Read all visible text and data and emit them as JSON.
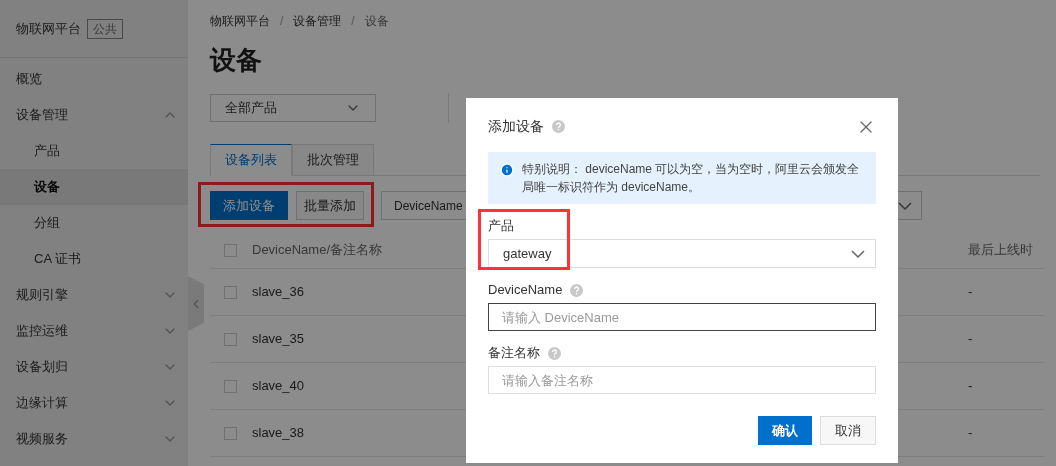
{
  "sidebar": {
    "title": "物联网平台",
    "tag": "公共",
    "items": [
      {
        "label": "概览",
        "selected": false
      },
      {
        "label": "设备管理",
        "selected": false,
        "expanded": true,
        "children": [
          {
            "label": "产品",
            "selected": false
          },
          {
            "label": "设备",
            "selected": true
          },
          {
            "label": "分组",
            "selected": false
          },
          {
            "label": "CA 证书",
            "selected": false
          }
        ]
      },
      {
        "label": "规则引擎",
        "selected": false,
        "expanded": false
      },
      {
        "label": "监控运维",
        "selected": false,
        "expanded": false
      },
      {
        "label": "设备划归",
        "selected": false,
        "expanded": false
      },
      {
        "label": "边缘计算",
        "selected": false,
        "expanded": false
      },
      {
        "label": "视频服务",
        "selected": false,
        "expanded": false
      }
    ]
  },
  "breadcrumb": [
    {
      "kind": "link",
      "text": "物联网平台"
    },
    {
      "kind": "separator",
      "text": "/"
    },
    {
      "kind": "link",
      "text": "设备管理"
    },
    {
      "kind": "separator",
      "text": "/"
    },
    {
      "kind": "current",
      "text": "设备"
    }
  ],
  "page_title": "设备",
  "product_select": {
    "value": "全部产品"
  },
  "tabs": [
    {
      "label": "设备列表",
      "selected": true
    },
    {
      "label": "批次管理",
      "selected": false
    }
  ],
  "toolbar": {
    "buttons": [
      {
        "label": "添加设备",
        "kind": "primary"
      },
      {
        "label": "批量添加",
        "kind": "secondary"
      }
    ],
    "filter": {
      "value": "DeviceName"
    }
  },
  "table": {
    "all_checked": false,
    "columns": [
      "DeviceName/备注名称",
      "最后上线时"
    ],
    "rows": [
      {
        "name": "slave_36",
        "last_online": "-",
        "checked": false
      },
      {
        "name": "slave_35",
        "last_online": "-",
        "checked": false
      },
      {
        "name": "slave_40",
        "last_online": "-",
        "checked": false
      },
      {
        "name": "slave_38",
        "last_online": "-",
        "checked": false
      }
    ]
  },
  "dialog": {
    "title": "添加设备",
    "notice": "特别说明： deviceName 可以为空，当为空时，阿里云会颁发全局唯一标识符作为 deviceName。",
    "fields": [
      {
        "label": "产品",
        "kind": "select",
        "value": "gateway",
        "help": false
      },
      {
        "label": "DeviceName",
        "kind": "input",
        "placeholder": "请输入 DeviceName",
        "help": true,
        "focused": true
      },
      {
        "label": "备注名称",
        "kind": "input",
        "placeholder": "请输入备注名称",
        "help": true,
        "focused": false
      }
    ],
    "buttons": [
      {
        "label": "确认",
        "kind": "primary"
      },
      {
        "label": "取消",
        "kind": "secondary"
      }
    ]
  }
}
